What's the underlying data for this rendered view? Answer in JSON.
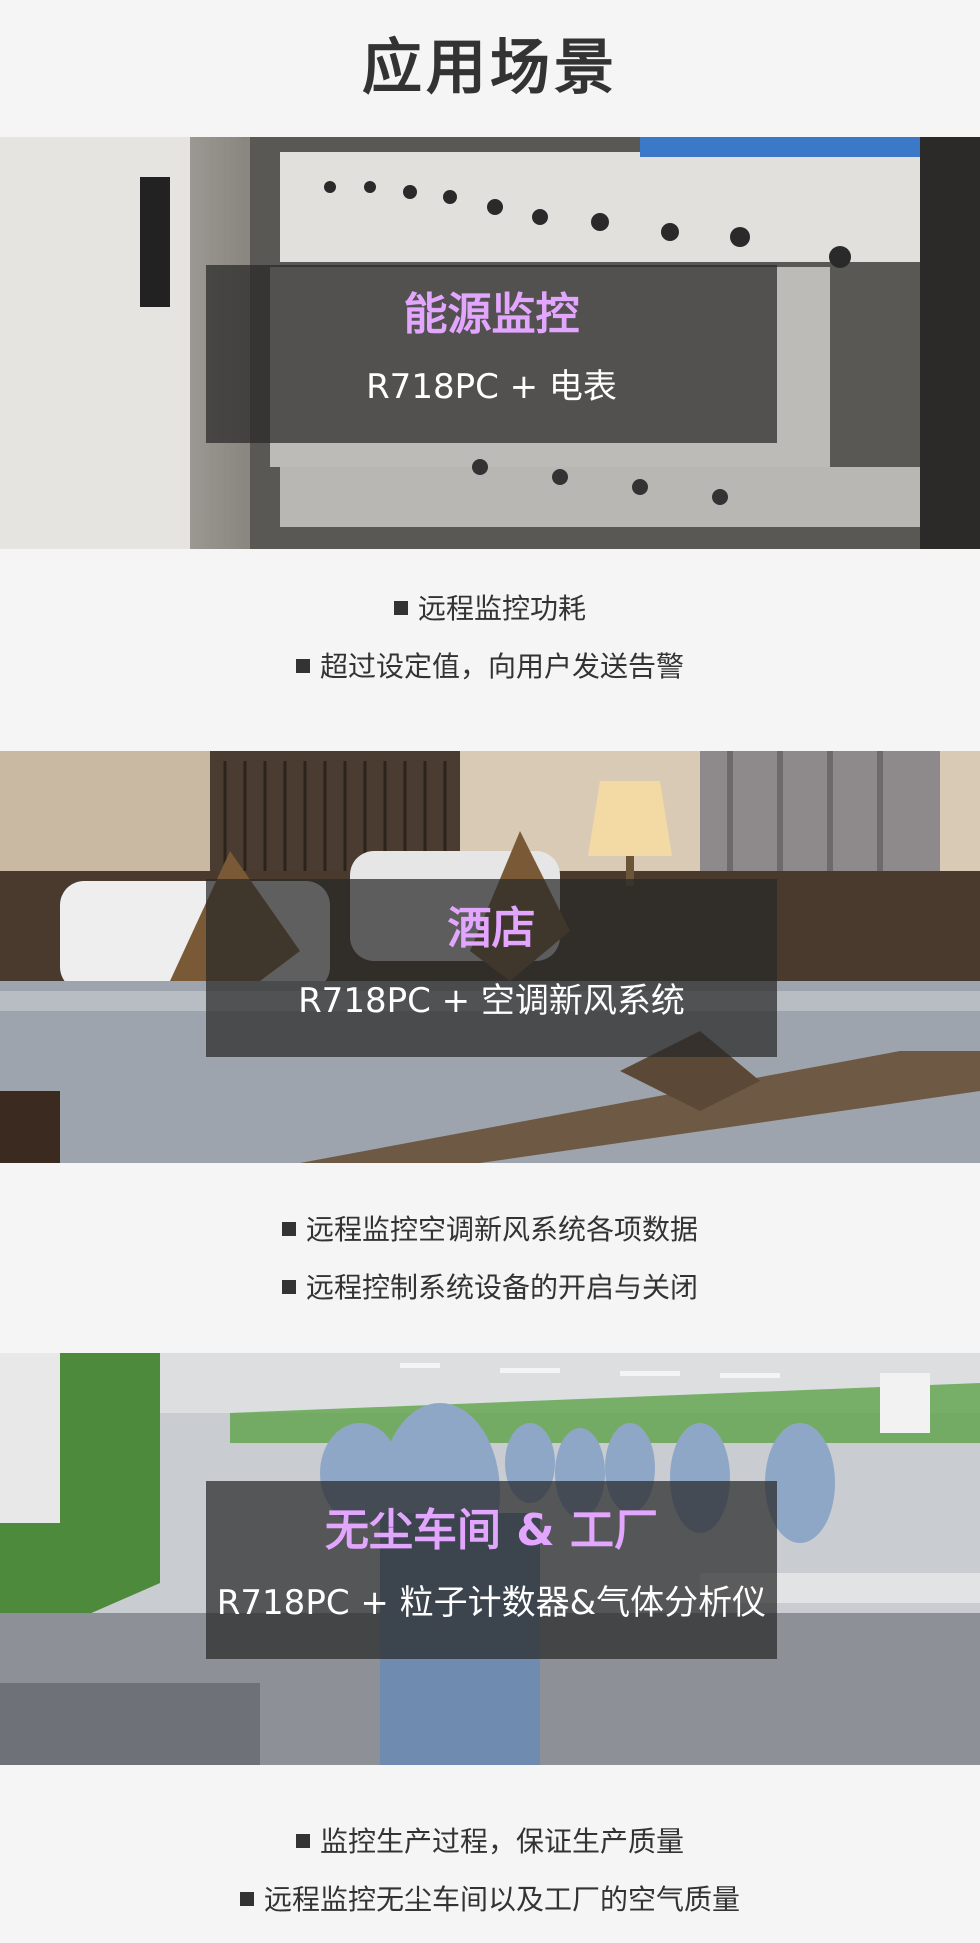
{
  "page": {
    "title": "应用场景"
  },
  "sections": [
    {
      "image": "electrical-panel-photo",
      "title": "能源监控",
      "subtitle": "R718PC + 电表",
      "bullets": [
        "远程监控功耗",
        "超过设定值，向用户发送告警"
      ]
    },
    {
      "image": "hotel-bedroom-photo",
      "title": "酒店",
      "subtitle": "R718PC + 空调新风系统",
      "bullets": [
        "远程监控空调新风系统各项数据",
        "远程控制系统设备的开启与关闭"
      ]
    },
    {
      "image": "cleanroom-factory-photo",
      "title": "无尘车间 & 工厂",
      "subtitle": "R718PC + 粒子计数器&气体分析仪",
      "bullets": [
        "监控生产过程，保证生产质量",
        "远程监控无尘车间以及工厂的空气质量"
      ]
    }
  ],
  "colors": {
    "accent": "#e3a6ff",
    "text": "#333333",
    "background": "#f5f5f5"
  }
}
